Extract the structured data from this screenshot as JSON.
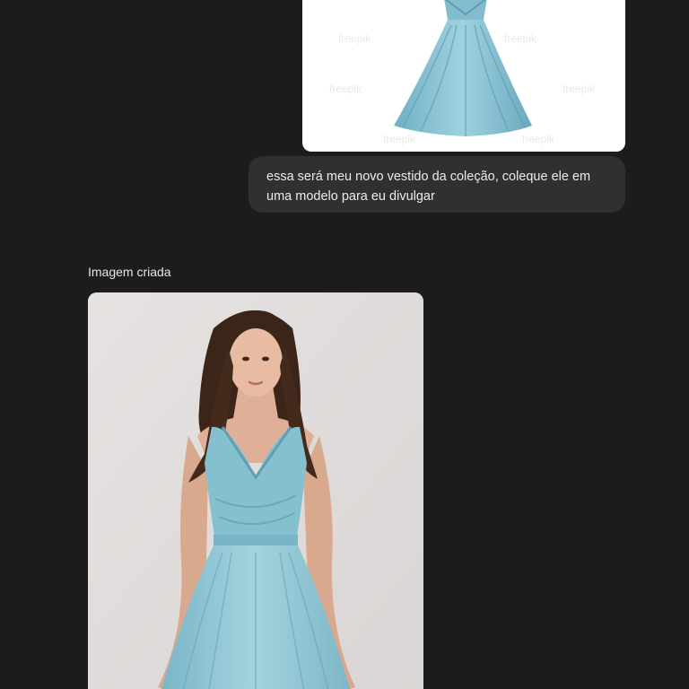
{
  "conversation": {
    "user_message": {
      "image_alt": "Vestido azul claro sem mangas com decote em V transpassado e saia rodada",
      "watermark": "freepik",
      "text": "essa será meu novo vestido da coleção, coleque ele em uma modelo para eu divulgar"
    },
    "assistant_message": {
      "label": "Imagem criada",
      "image_alt": "Modelo usando o vestido azul claro"
    }
  },
  "colors": {
    "background": "#1c1c1c",
    "bubble": "#303030",
    "dress": "#8fc4d3",
    "studio_backdrop": "#e2dfde"
  }
}
